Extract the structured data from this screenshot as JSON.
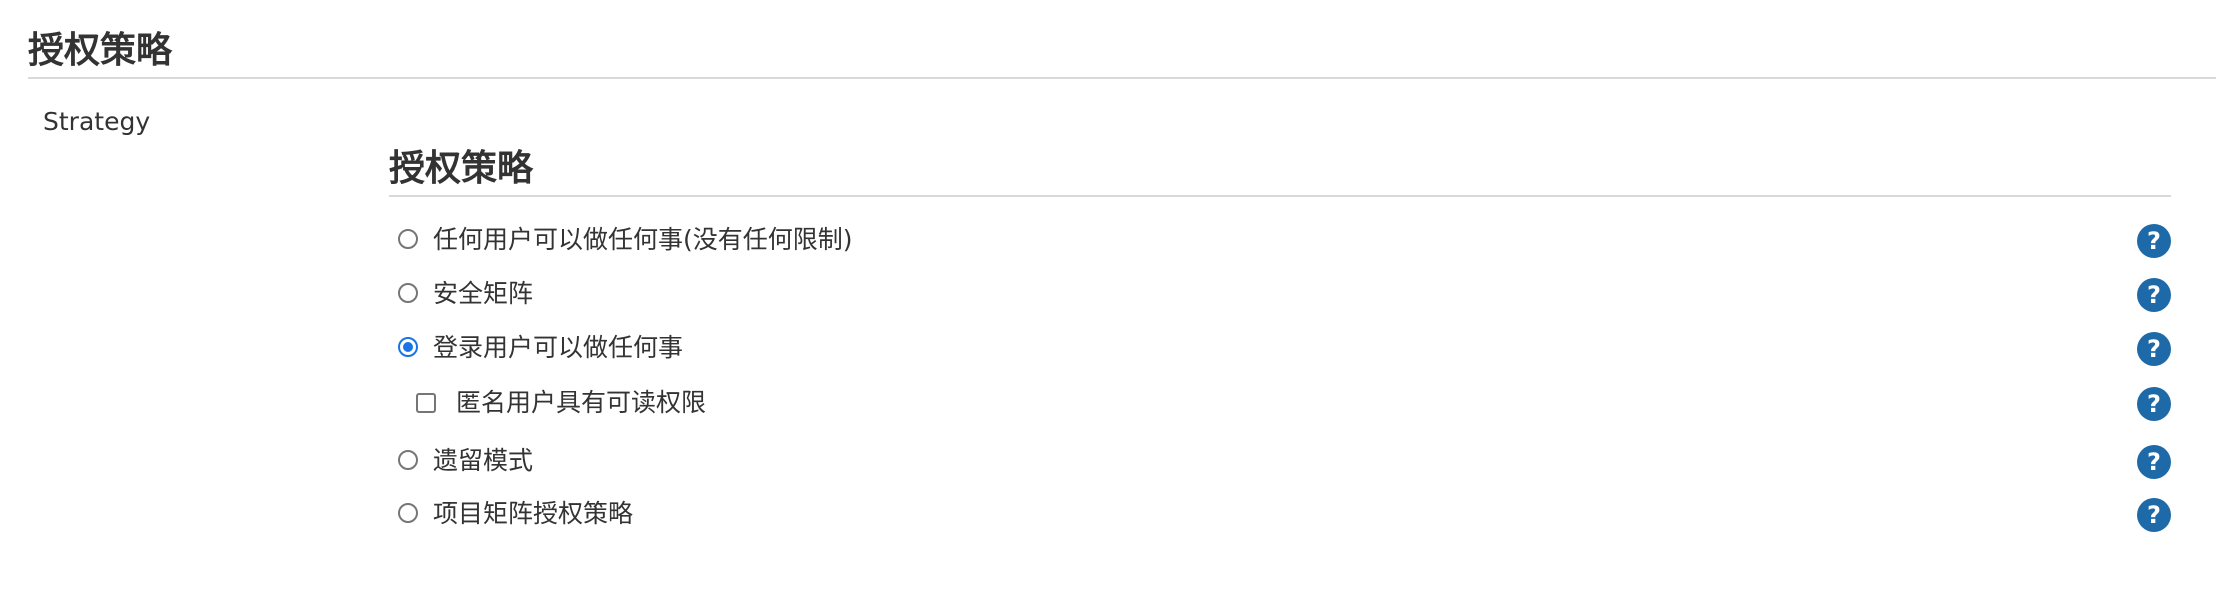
{
  "section": {
    "title": "授权策略"
  },
  "strategy": {
    "label": "Strategy",
    "title": "授权策略",
    "help_glyph": "?",
    "options": [
      {
        "label": "任何用户可以做任何事(没有任何限制)",
        "selected": false
      },
      {
        "label": "安全矩阵",
        "selected": false
      },
      {
        "label": "登录用户可以做任何事",
        "selected": true
      },
      {
        "label": "遗留模式",
        "selected": false
      },
      {
        "label": "项目矩阵授权策略",
        "selected": false
      }
    ],
    "sub_option": {
      "label": "匿名用户具有可读权限",
      "checked": false
    }
  }
}
